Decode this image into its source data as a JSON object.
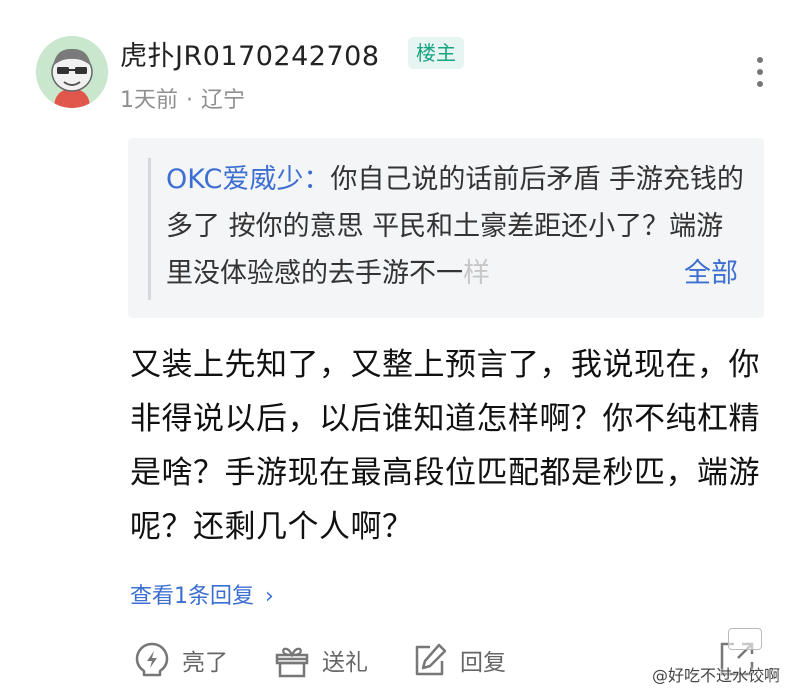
{
  "post": {
    "username": "虎扑JR0170242708",
    "badge": "楼主",
    "time": "1天前",
    "separator": "·",
    "location": "辽宁"
  },
  "quote": {
    "author": "OKC爱威少：",
    "text": "你自己说的话前后矛盾 手游充钱的多了 按你的意思 平民和土豪差距还小了？端游里没体验感的去手游不一",
    "text_faded": "样",
    "expand_label": "全部"
  },
  "comment": {
    "body": "又装上先知了，又整上预言了，我说现在，你非得说以后，以后谁知道怎样啊？你不纯杠精是啥？手游现在最高段位匹配都是秒匹，端游呢？还剩几个人啊？"
  },
  "replies": {
    "label": "查看1条回复",
    "chevron": "›"
  },
  "actions": {
    "like_label": "亮了",
    "gift_label": "送礼",
    "reply_label": "回复"
  },
  "watermark": {
    "text": "@好吃不过水饺啊"
  },
  "colors": {
    "accent_blue": "#3c6fd1",
    "badge_green": "#18a383",
    "badge_bg": "#e6f5f1",
    "quote_bg": "#f4f5f7",
    "meta_gray": "#8f8f8f"
  },
  "icons": {
    "avatar": "avatar-cartoon",
    "more": "more-vertical-icon",
    "like": "lightning-bulb-icon",
    "gift": "gift-icon",
    "reply": "edit-icon",
    "share": "share-icon"
  }
}
